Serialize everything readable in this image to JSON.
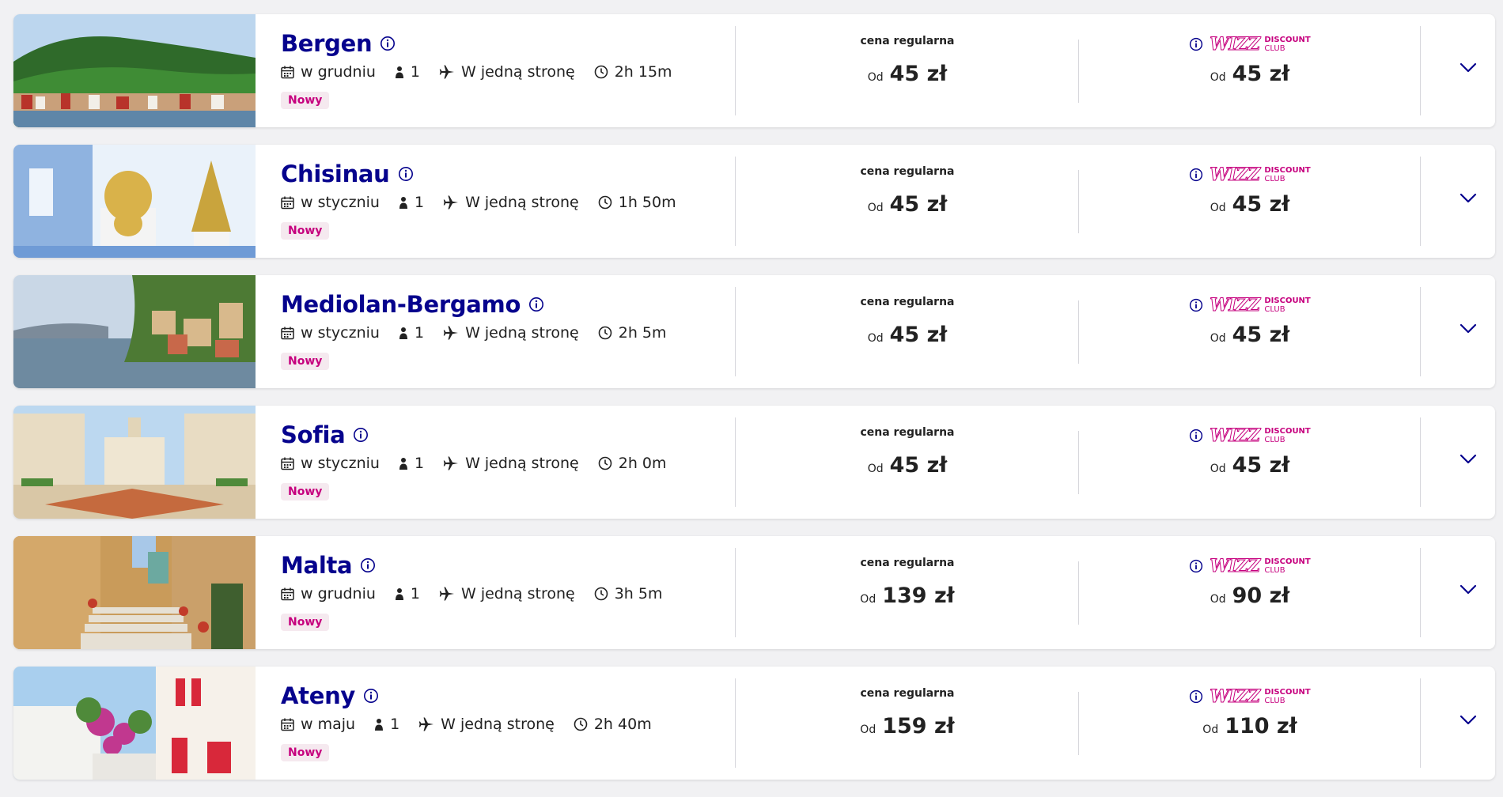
{
  "flights": [
    {
      "city": "Bergen",
      "month": "w grudniu",
      "passengers": "1",
      "trip_type": "W jedną stronę",
      "duration": "2h 15m",
      "badge": "Nowy",
      "regular_label": "cena regularna",
      "od_label": "Od",
      "regular_price": "45 zł",
      "club_price": "45 zł",
      "photo": "bergen-harbour-hills"
    },
    {
      "city": "Chisinau",
      "month": "w styczniu",
      "passengers": "1",
      "trip_type": "W jedną stronę",
      "duration": "1h 50m",
      "badge": "Nowy",
      "regular_label": "cena regularna",
      "od_label": "Od",
      "regular_price": "45 zł",
      "club_price": "45 zł",
      "photo": "church-golden-domes"
    },
    {
      "city": "Mediolan-Bergamo",
      "month": "w styczniu",
      "passengers": "1",
      "trip_type": "W jedną stronę",
      "duration": "2h 5m",
      "badge": "Nowy",
      "regular_label": "cena regularna",
      "od_label": "Od",
      "regular_price": "45 zł",
      "club_price": "45 zł",
      "photo": "lake-village"
    },
    {
      "city": "Sofia",
      "month": "w styczniu",
      "passengers": "1",
      "trip_type": "W jedną stronę",
      "duration": "2h 0m",
      "badge": "Nowy",
      "regular_label": "cena regularna",
      "od_label": "Od",
      "regular_price": "45 zł",
      "club_price": "45 zł",
      "photo": "city-square"
    },
    {
      "city": "Malta",
      "month": "w grudniu",
      "passengers": "1",
      "trip_type": "W jedną stronę",
      "duration": "3h 5m",
      "badge": "Nowy",
      "regular_label": "cena regularna",
      "od_label": "Od",
      "regular_price": "139 zł",
      "club_price": "90 zł",
      "photo": "stone-alley-stairs"
    },
    {
      "city": "Ateny",
      "month": "w maju",
      "passengers": "1",
      "trip_type": "W jedną stronę",
      "duration": "2h 40m",
      "badge": "Nowy",
      "regular_label": "cena regularna",
      "od_label": "Od",
      "regular_price": "159 zł",
      "club_price": "110 zł",
      "photo": "white-houses-red-shutters"
    }
  ],
  "club": {
    "brand": "WIZZ",
    "line1": "DISCOUNT",
    "line2": "CLUB"
  },
  "colors": {
    "brand_navy": "#06038d",
    "brand_magenta": "#c6007e",
    "badge_bg": "#f5e9ef",
    "page_bg": "#f1f1f3"
  },
  "icons": {
    "date": "calendar-icon",
    "passengers": "person-icon",
    "trip": "plane-icon",
    "duration": "clock-icon",
    "info": "info-icon",
    "expand": "chevron-down-icon"
  }
}
